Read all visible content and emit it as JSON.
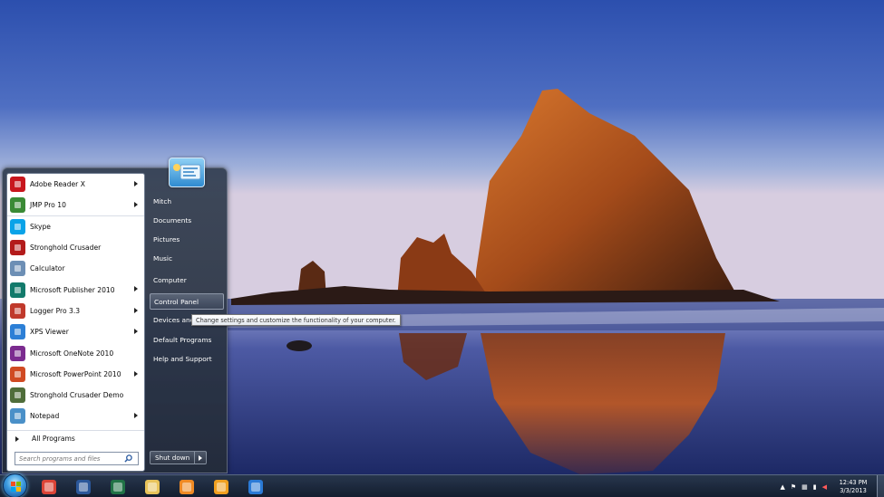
{
  "colors": {
    "sky_top": "#2f54b2",
    "sky_bottom": "#c6cde6",
    "rock": "#b3561f",
    "sea": "#2f3f7a",
    "taskbar": "#1c2a3c",
    "start_menu": "#2f3a4b"
  },
  "start_menu": {
    "programs": [
      {
        "label": "Adobe Reader X",
        "icon": "adobe-reader-icon",
        "color": "#c8161d",
        "submenu": true
      },
      {
        "label": "JMP Pro 10",
        "icon": "jmp-icon",
        "color": "#3a8a35",
        "submenu": true
      },
      {
        "label": "Skype",
        "icon": "skype-icon",
        "color": "#0aa3e8",
        "submenu": false
      },
      {
        "label": "Stronghold Crusader",
        "icon": "shield-icon",
        "color": "#b31b1b",
        "submenu": false
      },
      {
        "label": "Calculator",
        "icon": "calculator-icon",
        "color": "#6d8fb5",
        "submenu": false
      },
      {
        "label": "Microsoft Publisher 2010",
        "icon": "publisher-icon",
        "color": "#137a6b",
        "submenu": true
      },
      {
        "label": "Logger Pro 3.3",
        "icon": "logger-pro-icon",
        "color": "#c0392b",
        "submenu": true
      },
      {
        "label": "XPS Viewer",
        "icon": "xps-viewer-icon",
        "color": "#2c7fd6",
        "submenu": true
      },
      {
        "label": "Microsoft OneNote 2010",
        "icon": "onenote-icon",
        "color": "#7b2b8f",
        "submenu": false
      },
      {
        "label": "Microsoft PowerPoint 2010",
        "icon": "powerpoint-icon",
        "color": "#d04a23",
        "submenu": true
      },
      {
        "label": "Stronghold Crusader Demo",
        "icon": "crusader-demo-icon",
        "color": "#4f6d3a",
        "submenu": false
      },
      {
        "label": "Notepad",
        "icon": "notepad-icon",
        "color": "#4a90c8",
        "submenu": true
      }
    ],
    "all_programs": "All Programs",
    "search_placeholder": "Search programs and files",
    "right_links": [
      "Mitch",
      "Documents",
      "Pictures",
      "Music",
      "Computer",
      "Control Panel",
      "Devices and P",
      "Default Programs",
      "Help and Support"
    ],
    "shutdown_label": "Shut down",
    "tooltip": "Change settings and customize the functionality of your computer."
  },
  "taskbar": {
    "pinned": [
      {
        "name": "chrome-icon",
        "color": "#db4437"
      },
      {
        "name": "word-icon",
        "color": "#2b579a"
      },
      {
        "name": "excel-icon",
        "color": "#217346"
      },
      {
        "name": "explorer-icon",
        "color": "#e8c35a"
      },
      {
        "name": "media-player-icon",
        "color": "#f08a24"
      },
      {
        "name": "outlook-icon",
        "color": "#f0a020"
      },
      {
        "name": "internet-explorer-icon",
        "color": "#2a7ad6"
      }
    ],
    "time": "12:43 PM",
    "date": "3/3/2013"
  }
}
